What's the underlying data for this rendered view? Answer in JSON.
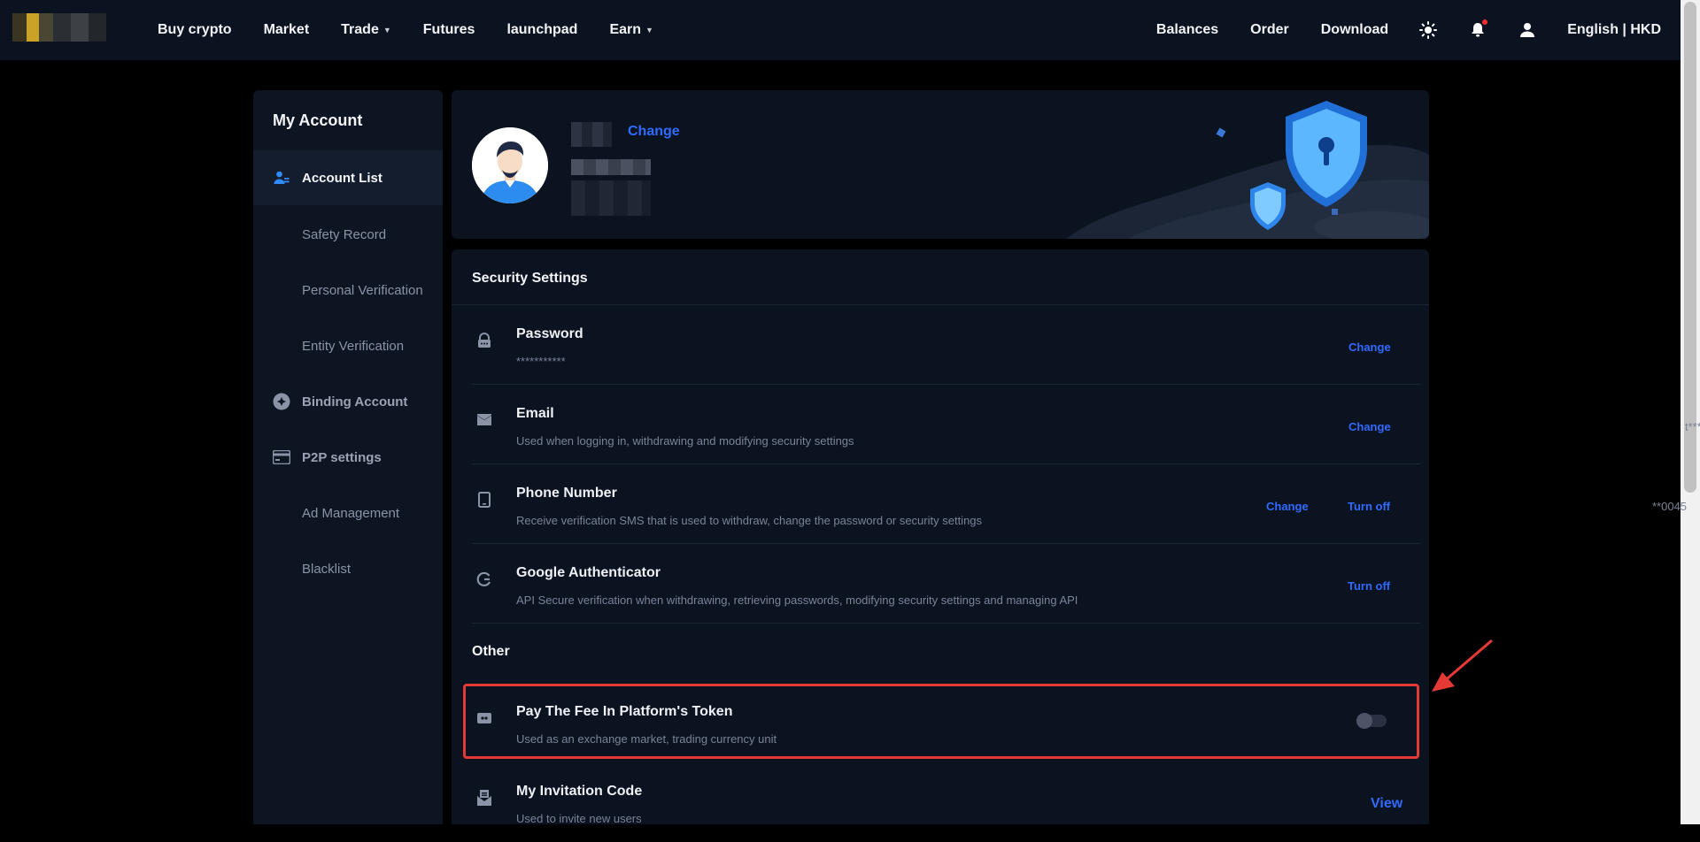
{
  "topbar": {
    "nav": [
      {
        "label": "Buy crypto",
        "caret": false
      },
      {
        "label": "Market",
        "caret": false
      },
      {
        "label": "Trade",
        "caret": true
      },
      {
        "label": "Futures",
        "caret": false
      },
      {
        "label": "launchpad",
        "caret": false
      },
      {
        "label": "Earn",
        "caret": true
      }
    ],
    "right": {
      "balances": "Balances",
      "order": "Order",
      "download": "Download",
      "language": "English | HKD"
    },
    "icons": [
      "sun-icon",
      "bell-icon",
      "user-icon"
    ]
  },
  "sidebar": {
    "title": "My Account",
    "items": [
      {
        "label": "Account List",
        "icon": "user-list-icon",
        "active": true
      },
      {
        "label": "Safety Record",
        "icon": "",
        "active": false
      },
      {
        "label": "Personal Verification",
        "icon": "",
        "active": false
      },
      {
        "label": "Entity Verification",
        "icon": "",
        "active": false
      },
      {
        "label": "Binding Account",
        "icon": "link-circle-icon",
        "active": false
      },
      {
        "label": "P2P settings",
        "icon": "card-icon",
        "active": false
      },
      {
        "label": "Ad Management",
        "icon": "",
        "active": false
      },
      {
        "label": "Blacklist",
        "icon": "",
        "active": false
      }
    ]
  },
  "profile": {
    "change_label": "Change"
  },
  "security": {
    "title": "Security Settings",
    "rows": [
      {
        "title": "Password",
        "desc": "***********",
        "value": "",
        "actions": [
          "Change"
        ],
        "icon": "lock-icon"
      },
      {
        "title": "Email",
        "desc": "Used when logging in, withdrawing and modifying security settings",
        "value": "t*****@abc.com",
        "actions": [
          "Change"
        ],
        "icon": "mail-icon"
      },
      {
        "title": "Phone Number",
        "desc": "Receive verification SMS that is used to withdraw, change the password or security settings",
        "value": "**0045",
        "actions": [
          "Change",
          "Turn off"
        ],
        "icon": "phone-icon"
      },
      {
        "title": "Google Authenticator",
        "desc": "API Secure verification when withdrawing, retrieving passwords, modifying security settings and managing API",
        "value": "",
        "actions": [
          "Turn off"
        ],
        "icon": "google-auth-icon"
      }
    ],
    "other_title": "Other",
    "other_rows": [
      {
        "title": "Pay The Fee In Platform's Token",
        "desc": "Used as an exchange market, trading currency unit",
        "toggle": false,
        "icon": "token-icon"
      },
      {
        "title": "My Invitation Code",
        "desc": "Used to invite new users",
        "action": "View",
        "icon": "invite-icon"
      }
    ]
  },
  "colors": {
    "accent": "#2f6bff",
    "highlight": "#e53935",
    "panel": "#0b1220"
  }
}
